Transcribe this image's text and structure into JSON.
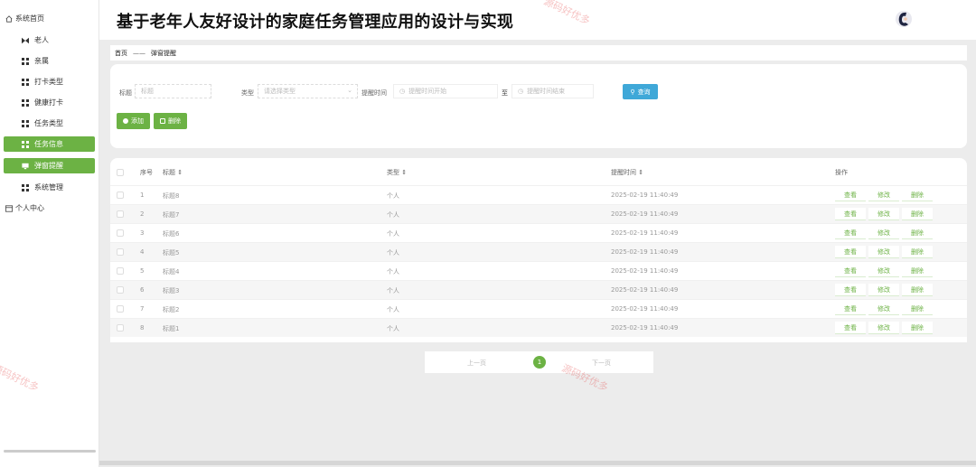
{
  "header": {
    "title": "基于老年人友好设计的家庭任务管理应用的设计与实现"
  },
  "sidebar": {
    "items": [
      {
        "label": "系统首页",
        "icon": "home-icon"
      },
      {
        "label": "老人",
        "icon": "grid-icon"
      },
      {
        "label": "亲属",
        "icon": "grid-icon"
      },
      {
        "label": "打卡类型",
        "icon": "grid-icon"
      },
      {
        "label": "健康打卡",
        "icon": "grid-icon"
      },
      {
        "label": "任务类型",
        "icon": "grid-icon"
      },
      {
        "label": "任务信息",
        "icon": "grid-icon"
      },
      {
        "label": "弹窗提醒",
        "icon": "monitor-icon"
      },
      {
        "label": "系统管理",
        "icon": "grid-icon"
      },
      {
        "label": "个人中心",
        "icon": "profile-icon"
      }
    ]
  },
  "breadcrumb": {
    "home": "首页",
    "sep": "——",
    "current": "弹窗提醒"
  },
  "search": {
    "title_label": "标题",
    "title_placeholder": "标题",
    "type_label": "类型",
    "type_placeholder": "请选择类型",
    "time_label": "提醒时间",
    "start_placeholder": "提醒时间开始",
    "to": "至",
    "end_placeholder": "提醒时间结束",
    "query": "查询",
    "add": "添加",
    "delete": "删除"
  },
  "table": {
    "headers": {
      "index": "序号",
      "title": "标题",
      "type": "类型",
      "time": "提醒时间",
      "ops": "操作"
    },
    "sort_mark": "⇕",
    "ops": {
      "view": "查看",
      "edit": "修改",
      "delete": "删除"
    },
    "rows": [
      {
        "index": "1",
        "title": "标题8",
        "type": "个人",
        "time": "2025-02-19 11:40:49"
      },
      {
        "index": "2",
        "title": "标题7",
        "type": "个人",
        "time": "2025-02-19 11:40:49"
      },
      {
        "index": "3",
        "title": "标题6",
        "type": "个人",
        "time": "2025-02-19 11:40:49"
      },
      {
        "index": "4",
        "title": "标题5",
        "type": "个人",
        "time": "2025-02-19 11:40:49"
      },
      {
        "index": "5",
        "title": "标题4",
        "type": "个人",
        "time": "2025-02-19 11:40:49"
      },
      {
        "index": "6",
        "title": "标题3",
        "type": "个人",
        "time": "2025-02-19 11:40:49"
      },
      {
        "index": "7",
        "title": "标题2",
        "type": "个人",
        "time": "2025-02-19 11:40:49"
      },
      {
        "index": "8",
        "title": "标题1",
        "type": "个人",
        "time": "2025-02-19 11:40:49"
      }
    ]
  },
  "pager": {
    "prev": "上一页",
    "current": "1",
    "next": "下一页"
  },
  "watermark": "源码好优多",
  "colors": {
    "accent": "#6cb244",
    "query": "#3fa8d8"
  }
}
